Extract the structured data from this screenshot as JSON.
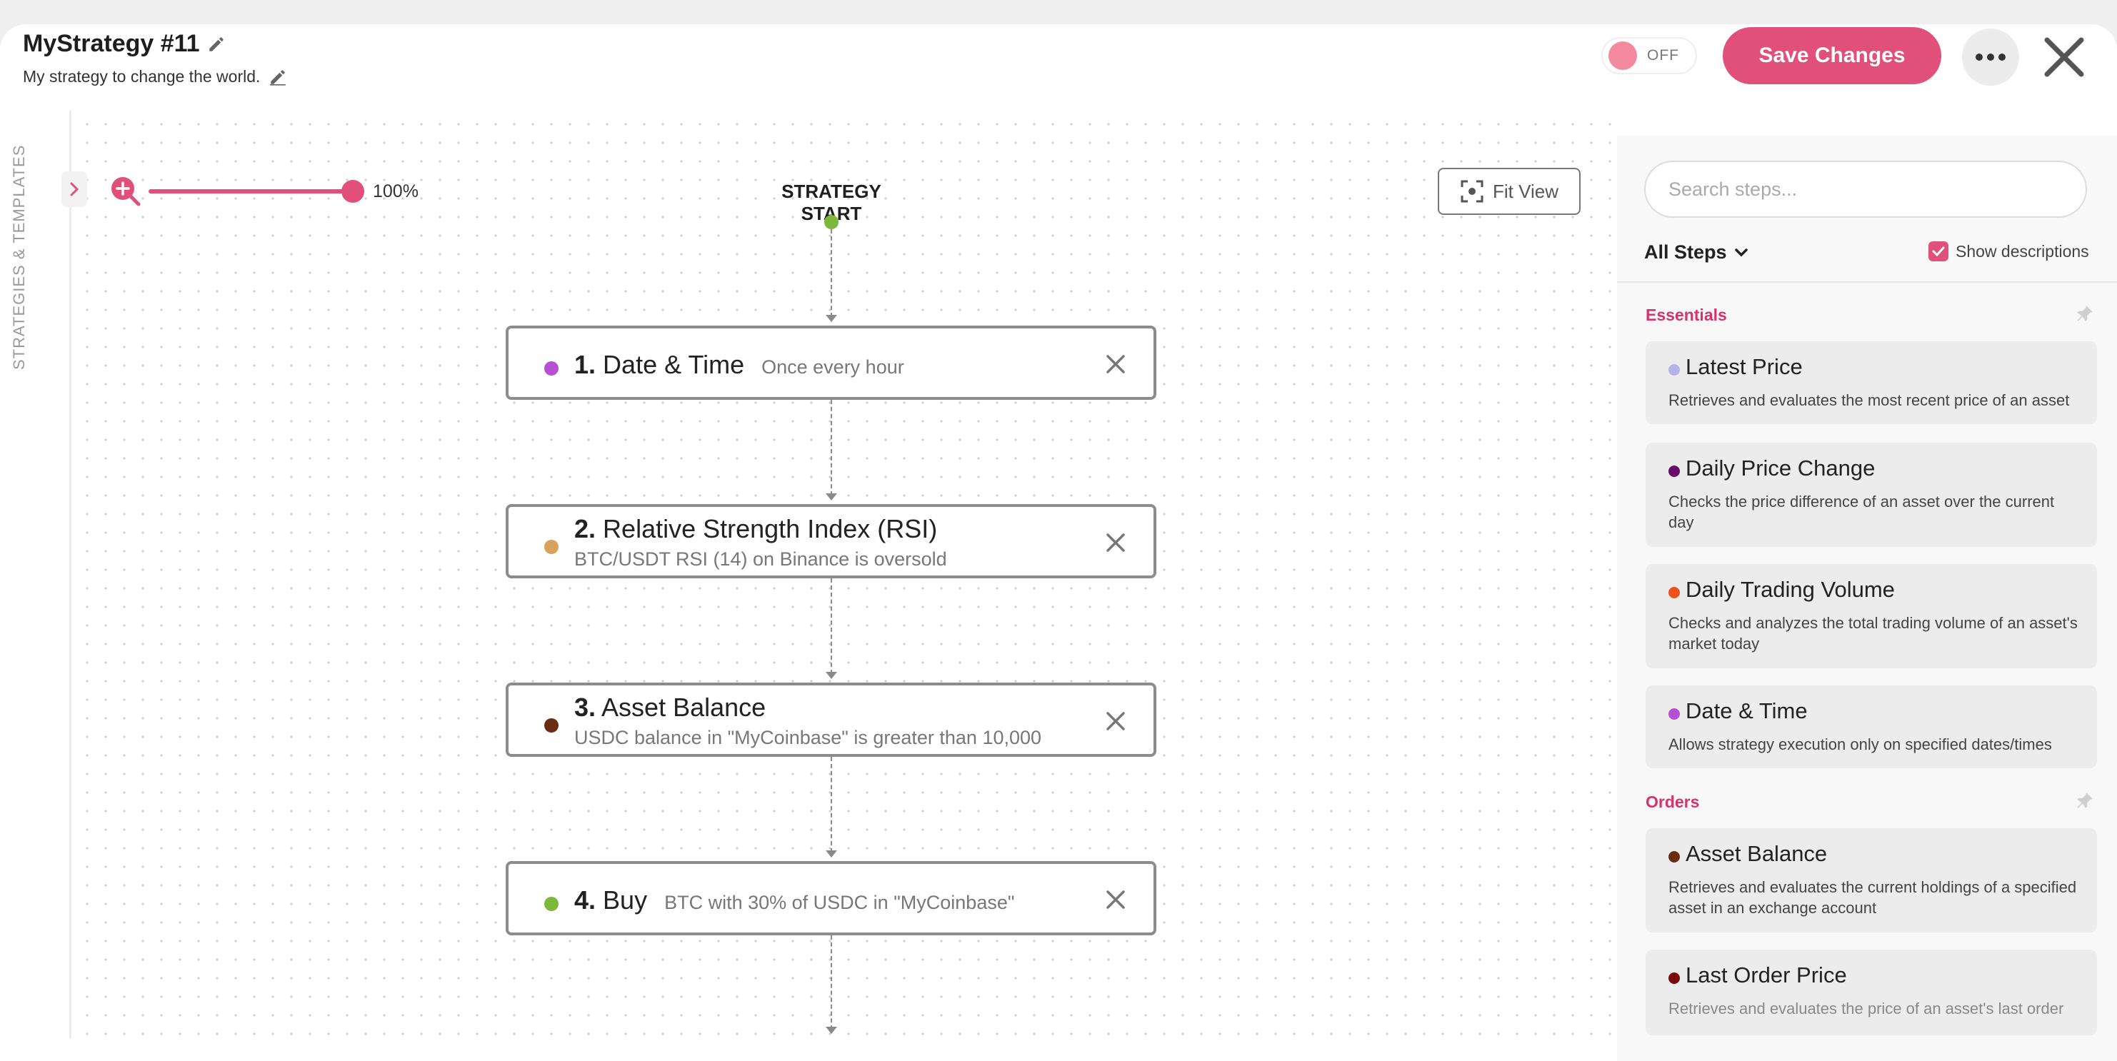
{
  "header": {
    "title": "MyStrategy #11",
    "subtitle": "My strategy to change the world.",
    "toggle_label": "OFF",
    "save_label": "Save Changes"
  },
  "sidebar": {
    "label": "STRATEGIES & TEMPLATES"
  },
  "canvas": {
    "zoom_label": "100%",
    "zoom_value": 100,
    "fit_view_label": "Fit View",
    "start_label": "STRATEGY START",
    "steps": [
      {
        "number": "1.",
        "name": "Date & Time",
        "desc": "Once every hour",
        "color": "#b64fd1"
      },
      {
        "number": "2.",
        "name": "Relative Strength Index (RSI)",
        "desc": "BTC/USDT RSI (14) on Binance is oversold",
        "color": "#d9a25c"
      },
      {
        "number": "3.",
        "name": "Asset Balance",
        "desc": "USDC balance in \"MyCoinbase\" is greater than 10,000",
        "color": "#6b2d12"
      },
      {
        "number": "4.",
        "name": "Buy",
        "desc": "BTC with 30% of USDC in \"MyCoinbase\"",
        "color": "#7cb83b"
      }
    ]
  },
  "panel": {
    "search_placeholder": "Search steps...",
    "filter_label": "All Steps",
    "show_descriptions_label": "Show descriptions",
    "sections": [
      {
        "title": "Essentials",
        "items": [
          {
            "title": "Latest Price",
            "desc": "Retrieves and evaluates the most recent price of an asset",
            "color": "#b3b3e6"
          },
          {
            "title": "Daily Price Change",
            "desc": "Checks the price difference of an asset over the current day",
            "color": "#6a0a6a"
          },
          {
            "title": "Daily Trading Volume",
            "desc": "Checks and analyzes the total trading volume of an asset's market today",
            "color": "#f0521d"
          },
          {
            "title": "Date & Time",
            "desc": "Allows strategy execution only on specified dates/times",
            "color": "#b64fd1"
          }
        ]
      },
      {
        "title": "Orders",
        "items": [
          {
            "title": "Asset Balance",
            "desc": "Retrieves and evaluates the current holdings of a specified asset in an exchange account",
            "color": "#6b2d12"
          },
          {
            "title": "Last Order Price",
            "desc": "Retrieves and evaluates the price of an asset's last order",
            "color": "#7a0a0a"
          }
        ]
      }
    ]
  },
  "colors": {
    "accent": "#e0507a",
    "section": "#d6336c",
    "start_dot": "#7cb83b"
  }
}
